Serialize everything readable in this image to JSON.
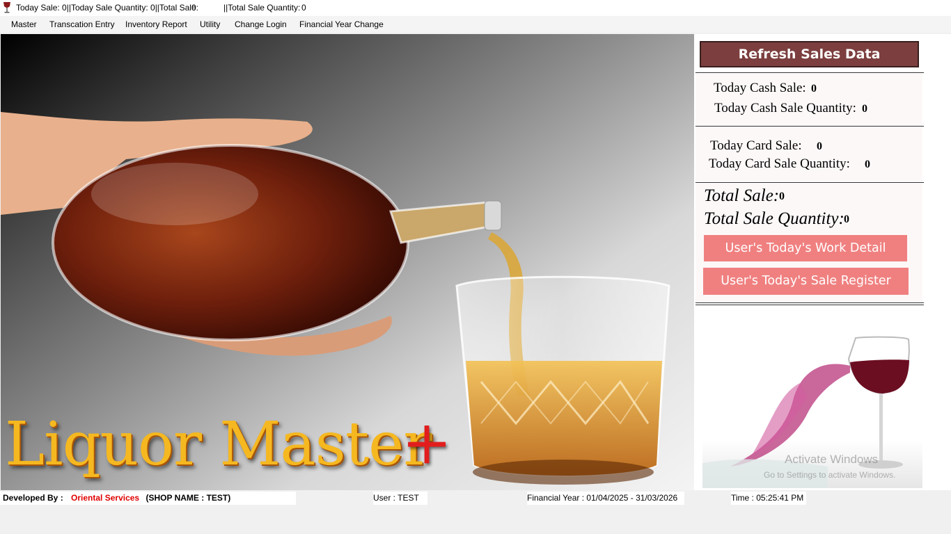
{
  "titlebar": {
    "today_sale": "Today Sale: 0||Today Sale Quantity: 0||Total Sale:",
    "total_sale_value": "0",
    "total_sale_qty_label": "||Total Sale Quantity:",
    "total_sale_qty_value": "0"
  },
  "menu": {
    "master": "Master",
    "transaction_entry": "Transcation Entry",
    "inventory_report": "Inventory Report",
    "utility": "Utility",
    "change_login": "Change Login",
    "financial_year_change": "Financial Year Change"
  },
  "hero": {
    "title": "Liquor Master",
    "plus": "+"
  },
  "panel": {
    "refresh_label": "Refresh Sales Data",
    "cash_sale_label": "Today Cash Sale:",
    "cash_sale_value": "0",
    "cash_qty_label": "Today Cash Sale Quantity:",
    "cash_qty_value": "0",
    "card_sale_label": "Today Card Sale:",
    "card_sale_value": "0",
    "card_qty_label": "Today Card Sale Quantity:",
    "card_qty_value": "0",
    "total_sale_label": "Total Sale:",
    "total_sale_value": "0",
    "total_qty_label": "Total Sale Quantity:",
    "total_qty_value": "0",
    "work_detail_label": "User's Today's Work Detail",
    "sale_register_label": "User's Today's Sale Register",
    "watermark_line1": "Activate Windows",
    "watermark_line2": "Go to Settings to activate Windows."
  },
  "status": {
    "developed_by_label": "Developed By :",
    "developer_name": "Oriental Services",
    "shop_name": "(SHOP NAME : TEST)",
    "user": "User :  TEST",
    "financial_year": "Financial Year : 01/04/2025 - 31/03/2026",
    "time": "Time : 05:25:41 PM"
  },
  "colors": {
    "refresh_button": "#7c3e3e",
    "action_buttons": "#f08080",
    "developer_name": "#e00000",
    "hero_title": "#f5b820",
    "hero_plus": "#e21d1d"
  }
}
